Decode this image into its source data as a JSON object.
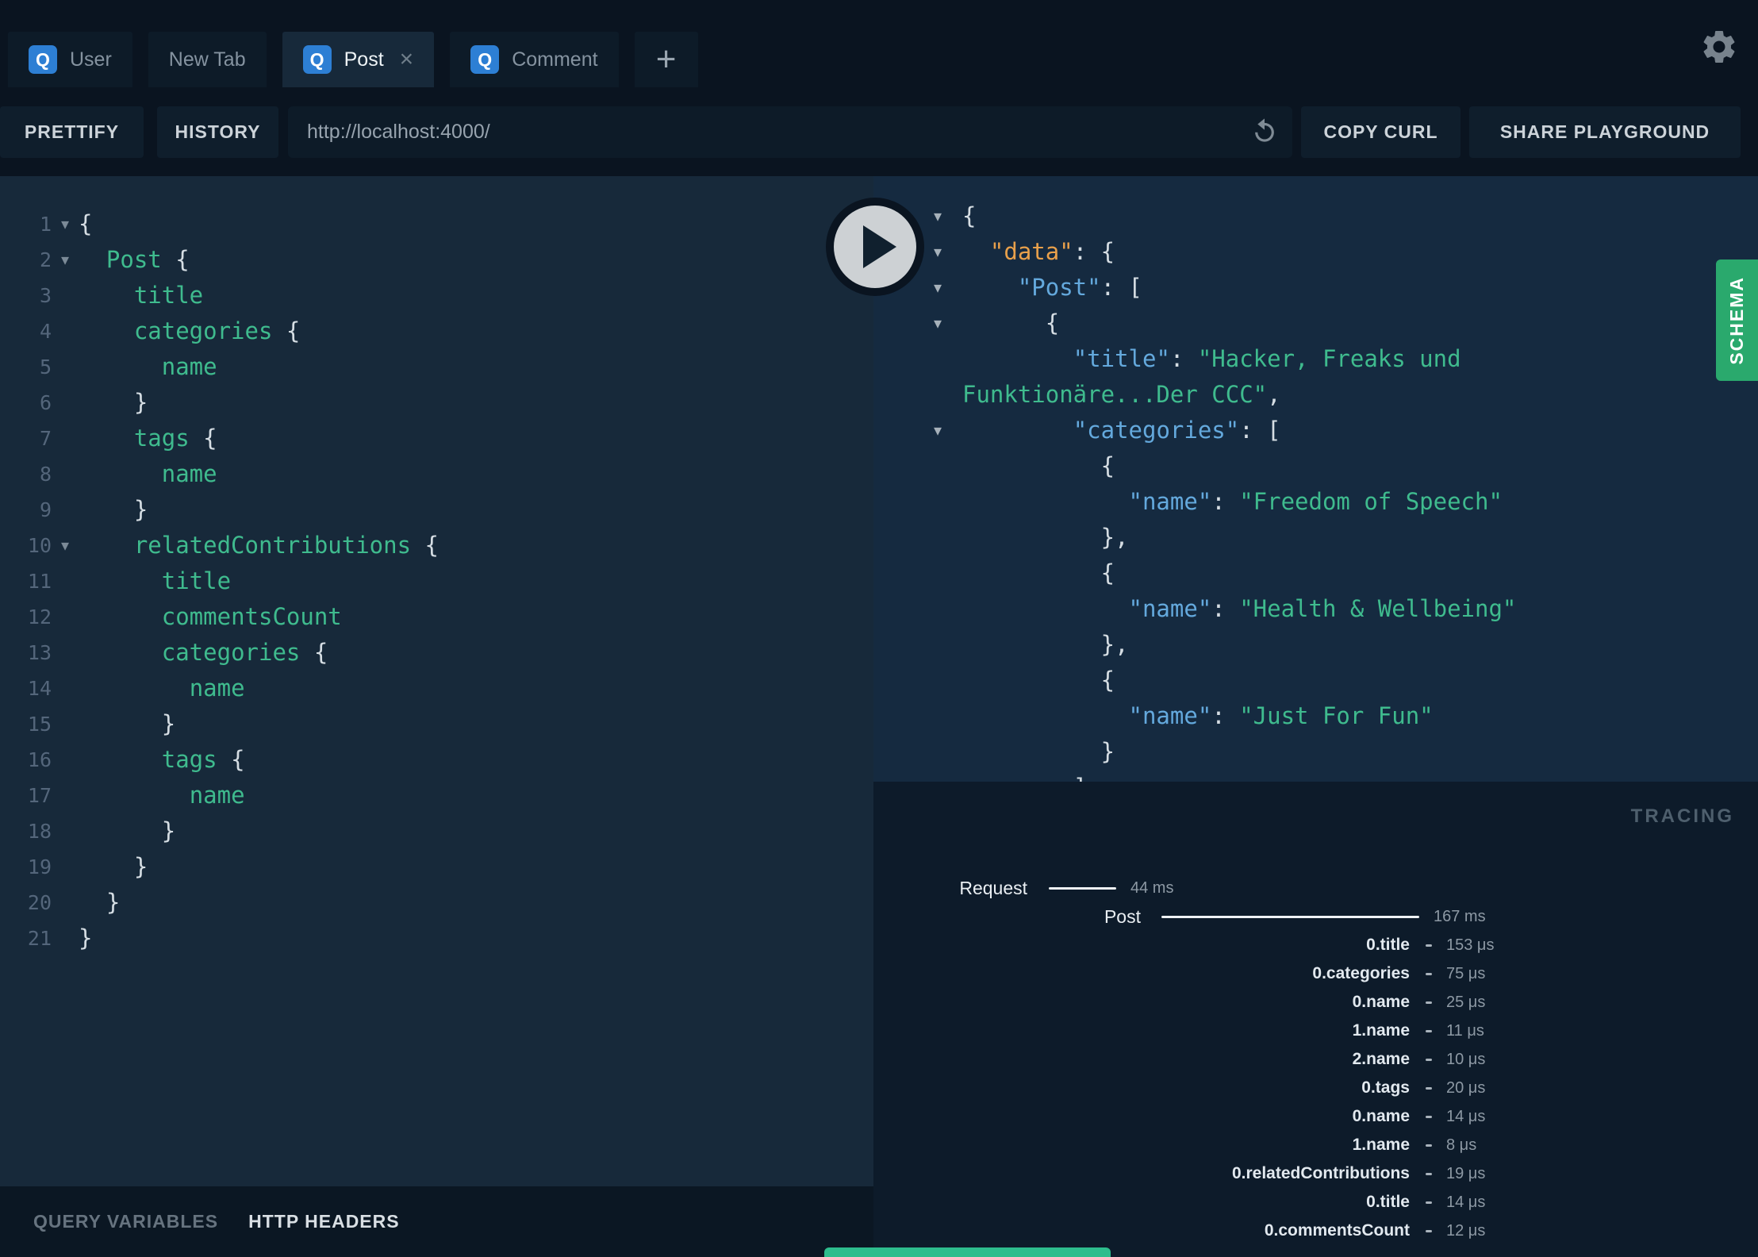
{
  "tabbar": {
    "tabs": [
      {
        "label": "User",
        "has_icon": true,
        "icon_letter": "Q",
        "active": false,
        "closable": false
      },
      {
        "label": "New Tab",
        "has_icon": false,
        "icon_letter": "",
        "active": false,
        "closable": false
      },
      {
        "label": "Post",
        "has_icon": true,
        "icon_letter": "Q",
        "active": true,
        "closable": true
      },
      {
        "label": "Comment",
        "has_icon": true,
        "icon_letter": "Q",
        "active": false,
        "closable": false
      }
    ],
    "new_tab_button": "+",
    "close_glyph": "×"
  },
  "toolbar": {
    "prettify_label": "PRETTIFY",
    "history_label": "HISTORY",
    "url_value": "http://localhost:4000/",
    "copy_curl_label": "COPY CURL",
    "share_label": "SHARE PLAYGROUND"
  },
  "code_glyphs": {
    "fold": "▾"
  },
  "editor": {
    "lines": [
      {
        "no": "1",
        "fold": true,
        "indent": 0,
        "tokens": [
          [
            "p",
            "{"
          ]
        ]
      },
      {
        "no": "2",
        "fold": true,
        "indent": 2,
        "tokens": [
          [
            "f",
            "Post"
          ],
          [
            "p",
            " {"
          ]
        ]
      },
      {
        "no": "3",
        "fold": false,
        "indent": 4,
        "tokens": [
          [
            "f",
            "title"
          ]
        ]
      },
      {
        "no": "4",
        "fold": false,
        "indent": 4,
        "tokens": [
          [
            "f",
            "categories"
          ],
          [
            "p",
            " {"
          ]
        ]
      },
      {
        "no": "5",
        "fold": false,
        "indent": 6,
        "tokens": [
          [
            "f",
            "name"
          ]
        ]
      },
      {
        "no": "6",
        "fold": false,
        "indent": 4,
        "tokens": [
          [
            "p",
            "}"
          ]
        ]
      },
      {
        "no": "7",
        "fold": false,
        "indent": 4,
        "tokens": [
          [
            "f",
            "tags"
          ],
          [
            "p",
            " {"
          ]
        ]
      },
      {
        "no": "8",
        "fold": false,
        "indent": 6,
        "tokens": [
          [
            "f",
            "name"
          ]
        ]
      },
      {
        "no": "9",
        "fold": false,
        "indent": 4,
        "tokens": [
          [
            "p",
            "}"
          ]
        ]
      },
      {
        "no": "10",
        "fold": true,
        "indent": 4,
        "tokens": [
          [
            "f",
            "relatedContributions"
          ],
          [
            "p",
            " {"
          ]
        ]
      },
      {
        "no": "11",
        "fold": false,
        "indent": 6,
        "tokens": [
          [
            "f",
            "title"
          ]
        ]
      },
      {
        "no": "12",
        "fold": false,
        "indent": 6,
        "tokens": [
          [
            "f",
            "commentsCount"
          ]
        ]
      },
      {
        "no": "13",
        "fold": false,
        "indent": 6,
        "tokens": [
          [
            "f",
            "categories"
          ],
          [
            "p",
            " {"
          ]
        ]
      },
      {
        "no": "14",
        "fold": false,
        "indent": 8,
        "tokens": [
          [
            "f",
            "name"
          ]
        ]
      },
      {
        "no": "15",
        "fold": false,
        "indent": 6,
        "tokens": [
          [
            "p",
            "}"
          ]
        ]
      },
      {
        "no": "16",
        "fold": false,
        "indent": 6,
        "tokens": [
          [
            "f",
            "tags"
          ],
          [
            "p",
            " {"
          ]
        ]
      },
      {
        "no": "17",
        "fold": false,
        "indent": 8,
        "tokens": [
          [
            "f",
            "name"
          ]
        ]
      },
      {
        "no": "18",
        "fold": false,
        "indent": 6,
        "tokens": [
          [
            "p",
            "}"
          ]
        ]
      },
      {
        "no": "19",
        "fold": false,
        "indent": 4,
        "tokens": [
          [
            "p",
            "}"
          ]
        ]
      },
      {
        "no": "20",
        "fold": false,
        "indent": 2,
        "tokens": [
          [
            "p",
            "}"
          ]
        ]
      },
      {
        "no": "21",
        "fold": false,
        "indent": 0,
        "tokens": [
          [
            "p",
            "}"
          ]
        ]
      }
    ]
  },
  "response": {
    "lines": [
      {
        "fold": true,
        "indent": 0,
        "tokens": [
          [
            "p",
            "{"
          ]
        ]
      },
      {
        "fold": true,
        "indent": 2,
        "tokens": [
          [
            "ko",
            "\"data\""
          ],
          [
            "p",
            ": {"
          ]
        ]
      },
      {
        "fold": true,
        "indent": 4,
        "tokens": [
          [
            "k",
            "\"Post\""
          ],
          [
            "p",
            ": ["
          ]
        ]
      },
      {
        "fold": true,
        "indent": 6,
        "tokens": [
          [
            "p",
            "{"
          ]
        ]
      },
      {
        "fold": false,
        "indent": 8,
        "tokens": [
          [
            "k",
            "\"title\""
          ],
          [
            "p",
            ": "
          ],
          [
            "s",
            "\"Hacker, Freaks und"
          ]
        ]
      },
      {
        "fold": false,
        "indent": 0,
        "tokens": [
          [
            "s",
            "Funktionäre...Der CCC\""
          ],
          [
            "p",
            ","
          ]
        ]
      },
      {
        "fold": true,
        "indent": 8,
        "tokens": [
          [
            "k",
            "\"categories\""
          ],
          [
            "p",
            ": ["
          ]
        ]
      },
      {
        "fold": false,
        "indent": 10,
        "tokens": [
          [
            "p",
            "{"
          ]
        ]
      },
      {
        "fold": false,
        "indent": 12,
        "tokens": [
          [
            "k",
            "\"name\""
          ],
          [
            "p",
            ": "
          ],
          [
            "s",
            "\"Freedom of Speech\""
          ]
        ]
      },
      {
        "fold": false,
        "indent": 10,
        "tokens": [
          [
            "p",
            "},"
          ]
        ]
      },
      {
        "fold": false,
        "indent": 10,
        "tokens": [
          [
            "p",
            "{"
          ]
        ]
      },
      {
        "fold": false,
        "indent": 12,
        "tokens": [
          [
            "k",
            "\"name\""
          ],
          [
            "p",
            ": "
          ],
          [
            "s",
            "\"Health & Wellbeing\""
          ]
        ]
      },
      {
        "fold": false,
        "indent": 10,
        "tokens": [
          [
            "p",
            "},"
          ]
        ]
      },
      {
        "fold": false,
        "indent": 10,
        "tokens": [
          [
            "p",
            "{"
          ]
        ]
      },
      {
        "fold": false,
        "indent": 12,
        "tokens": [
          [
            "k",
            "\"name\""
          ],
          [
            "p",
            ": "
          ],
          [
            "s",
            "\"Just For Fun\""
          ]
        ]
      },
      {
        "fold": false,
        "indent": 10,
        "tokens": [
          [
            "p",
            "}"
          ]
        ]
      },
      {
        "fold": false,
        "indent": 8,
        "tokens": [
          [
            "p",
            "]"
          ]
        ]
      }
    ]
  },
  "schema": {
    "label": "SCHEMA"
  },
  "tracing": {
    "title": "TRACING",
    "request_row": {
      "label": "Request",
      "duration": "44 ms"
    },
    "post_row": {
      "label": "Post",
      "duration": "167 ms"
    },
    "rows": [
      {
        "label": "0.title",
        "duration": "153 μs"
      },
      {
        "label": "0.categories",
        "duration": "75 μs"
      },
      {
        "label": "0.name",
        "duration": "25 μs"
      },
      {
        "label": "1.name",
        "duration": "11 μs"
      },
      {
        "label": "2.name",
        "duration": "10 μs"
      },
      {
        "label": "0.tags",
        "duration": "20 μs"
      },
      {
        "label": "0.name",
        "duration": "14 μs"
      },
      {
        "label": "1.name",
        "duration": "8 μs"
      },
      {
        "label": "0.relatedContributions",
        "duration": "19 μs"
      },
      {
        "label": "0.title",
        "duration": "14 μs"
      },
      {
        "label": "0.commentsCount",
        "duration": "12 μs"
      }
    ]
  },
  "bottom_bar": {
    "query_variables_label": "QUERY VARIABLES",
    "http_headers_label": "HTTP HEADERS"
  },
  "colors": {
    "tab_icon_blue": "#2d7fd4",
    "field_green": "#3fbb8e",
    "key_blue": "#64a9dd",
    "root_key_orange": "#e8a04b",
    "schema_green": "#2aa96d"
  }
}
